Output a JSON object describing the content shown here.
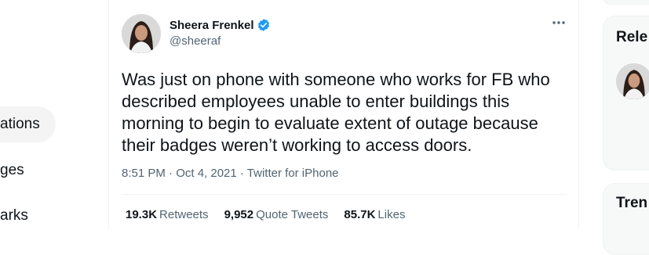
{
  "left_nav": {
    "items": [
      {
        "label": "ations"
      },
      {
        "label": "ges"
      },
      {
        "label": "arks"
      }
    ]
  },
  "tweet": {
    "author_name": "Sheera Frenkel",
    "handle": "@sheeraf",
    "more_icon": "more-horizontal-icon",
    "verified_icon": "verified-badge-icon",
    "text": "Was just on phone with someone who works for FB who described employees unable to enter buildings this morning to begin to evaluate extent of outage because their badges weren’t working to access doors.",
    "meta": "8:51 PM · Oct 4, 2021 · Twitter for iPhone",
    "stats": [
      {
        "count": "19.3K",
        "label": "Retweets"
      },
      {
        "count": "9,952",
        "label": "Quote Tweets"
      },
      {
        "count": "85.7K",
        "label": "Likes"
      }
    ]
  },
  "right_sidebar": {
    "relevant_title": "Rele",
    "trends_title": "Tren"
  },
  "colors": {
    "verified": "#1d9bf0",
    "secondary_text": "#536471",
    "primary_text": "#0f1419"
  }
}
